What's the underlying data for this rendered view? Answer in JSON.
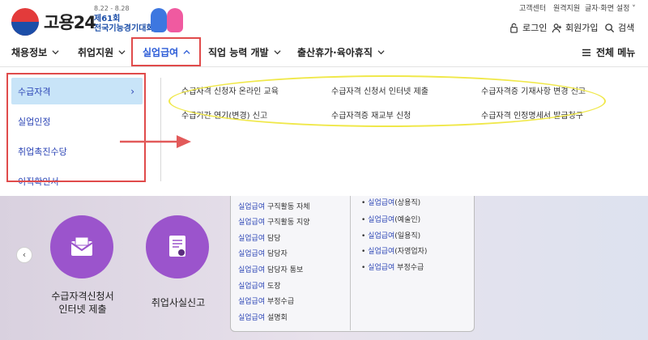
{
  "header": {
    "logo_text": "고용24",
    "event_date": "8.22 - 8.28",
    "event_name_1": "제61회",
    "event_name_2": "전국기능경기대회",
    "util_links": [
      "고객센터",
      "원격지원",
      "글자·화면 설정"
    ],
    "auth": {
      "login": "로그인",
      "signup": "회원가입",
      "search": "검색"
    }
  },
  "nav": {
    "items": [
      "채용정보",
      "취업지원",
      "실업급여",
      "직업 능력 개발",
      "출산휴가·육아휴직"
    ],
    "all_menu": "전체 메뉴"
  },
  "dropdown": {
    "sub_items": [
      "수급자격",
      "실업인정",
      "취업촉진수당",
      "이직확인서"
    ],
    "links": [
      "수급자격 신청자 온라인 교육",
      "수급자격 신청서 인터넷 제출",
      "수급자격증 기재사항 변경 신고",
      "수급기간 연기(변경) 신고",
      "수급자격증 재교부 신청",
      "수급자격 인정명세서 발급청구"
    ]
  },
  "content": {
    "card1_line1": "수급자격신청서",
    "card1_line2": "인터넷 제출",
    "card2": "취업사실신고",
    "left_prefix": "실업급여",
    "left_items": [
      "구직활동 자체",
      "구직활동 지양",
      "담당",
      "담당자",
      "담당자 통보",
      "도장",
      "부정수급",
      "설명회"
    ],
    "right_items": [
      "(상용직)",
      "(예술인)",
      "(일용직)",
      "(자영업자)",
      " 부정수급"
    ]
  },
  "colors": {
    "accent": "#2b5bd7",
    "highlight_red": "#e04b4b",
    "highlight_yellow": "#f0e84a",
    "purple": "#9b54cc",
    "active_bg": "#c8e4f8"
  }
}
